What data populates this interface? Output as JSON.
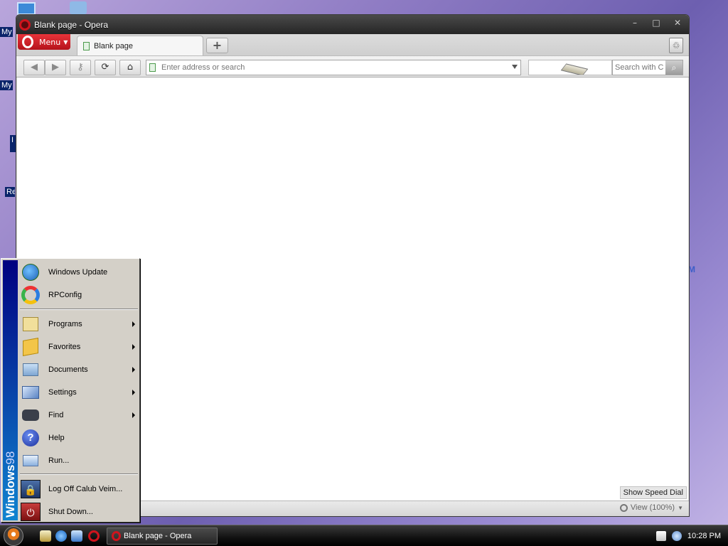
{
  "desktop": {
    "labels": [
      "My",
      "My I",
      "I",
      "Re"
    ],
    "corner_text": "M"
  },
  "window": {
    "title": "Blank page - Opera",
    "controls": [
      "–",
      "□",
      "✕"
    ]
  },
  "tabbar": {
    "menu_label": "Menu",
    "tab_title": "Blank page",
    "new_tab": "+"
  },
  "navbar": {
    "address_placeholder": "Enter address or search",
    "search_placeholder": "Search with C"
  },
  "content": {
    "speed_dial_label": "Show Speed Dial"
  },
  "statusbar": {
    "zoom_label": "View (100%)"
  },
  "start_menu": {
    "banner_bold": "Windows",
    "banner_light": "98",
    "items": [
      {
        "label": "Windows Update",
        "icon": "windows-update-icon",
        "submenu": false
      },
      {
        "label": "RPConfig",
        "icon": "rpconfig-icon",
        "submenu": false
      },
      {
        "label": "Programs",
        "icon": "programs-icon",
        "submenu": true
      },
      {
        "label": "Favorites",
        "icon": "favorites-icon",
        "submenu": true
      },
      {
        "label": "Documents",
        "icon": "documents-icon",
        "submenu": true
      },
      {
        "label": "Settings",
        "icon": "settings-icon",
        "submenu": true
      },
      {
        "label": "Find",
        "icon": "find-icon",
        "submenu": true
      },
      {
        "label": "Help",
        "icon": "help-icon",
        "submenu": false
      },
      {
        "label": "Run...",
        "icon": "run-icon",
        "submenu": false
      },
      {
        "label": "Log Off Calub Veim...",
        "icon": "lock-icon",
        "submenu": false
      },
      {
        "label": "Shut Down...",
        "icon": "shutdown-icon",
        "submenu": false
      }
    ]
  },
  "taskbar": {
    "task_label": "Blank page - Opera",
    "clock": "10:28 PM"
  }
}
